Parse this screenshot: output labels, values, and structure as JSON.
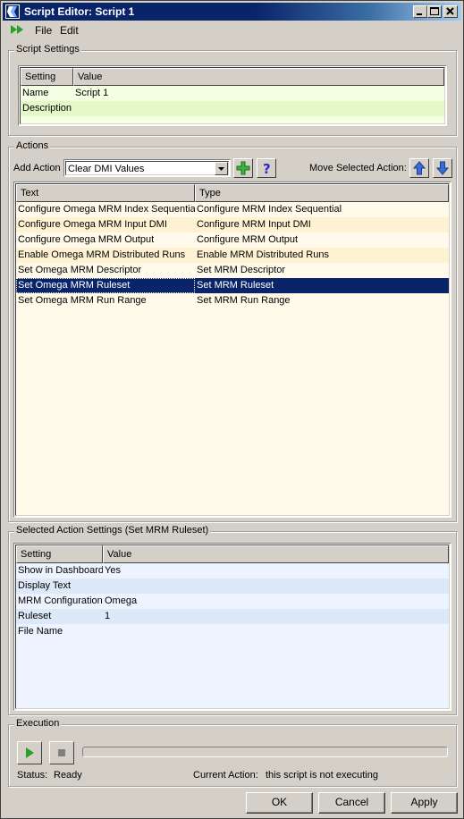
{
  "window": {
    "title": "Script Editor: Script 1"
  },
  "menu": {
    "file": "File",
    "edit": "Edit"
  },
  "script_settings": {
    "title": "Script Settings",
    "columns": [
      "Setting",
      "Value"
    ],
    "rows": [
      {
        "setting": "Name",
        "value": "Script 1"
      },
      {
        "setting": "Description",
        "value": ""
      }
    ]
  },
  "actions": {
    "title": "Actions",
    "add_action_label": "Add Action",
    "add_action_value": "Clear DMI Values",
    "move_label": "Move Selected Action:",
    "columns": [
      "Text",
      "Type"
    ],
    "rows": [
      {
        "text": "Configure Omega MRM Index Sequential",
        "type": "Configure MRM Index Sequential"
      },
      {
        "text": "Configure Omega MRM Input DMI",
        "type": "Configure MRM Input DMI"
      },
      {
        "text": "Configure Omega MRM Output",
        "type": "Configure MRM Output"
      },
      {
        "text": "Enable Omega MRM Distributed Runs",
        "type": "Enable MRM Distributed Runs"
      },
      {
        "text": "Set Omega MRM Descriptor",
        "type": "Set MRM Descriptor"
      },
      {
        "text": "Set Omega MRM Ruleset",
        "type": "Set MRM Ruleset"
      },
      {
        "text": "Set Omega MRM Run Range",
        "type": "Set MRM Run Range"
      }
    ],
    "selected_index": 5
  },
  "selected_action_settings": {
    "title": "Selected Action Settings (Set MRM Ruleset)",
    "columns": [
      "Setting",
      "Value"
    ],
    "rows": [
      {
        "setting": "Show in Dashboard",
        "value": "Yes"
      },
      {
        "setting": "Display Text",
        "value": ""
      },
      {
        "setting": "MRM Configuration",
        "value": "Omega"
      },
      {
        "setting": "Ruleset",
        "value": "1"
      },
      {
        "setting": "File Name",
        "value": ""
      }
    ]
  },
  "execution": {
    "title": "Execution",
    "progress": 0,
    "status_label": "Status:",
    "status_value": "Ready",
    "current_action_label": "Current Action:",
    "current_action_value": "this script is not executing"
  },
  "buttons": {
    "ok": "OK",
    "cancel": "Cancel",
    "apply": "Apply"
  },
  "colors": {
    "title_bar": "#0a246a",
    "selection": "#0a246a",
    "script_row_even": "#f4ffe4",
    "script_row_odd": "#e4f8c8",
    "action_row_even": "#fffaea",
    "action_row_odd": "#fff2d2",
    "setting_row_even": "#eef4ff",
    "setting_row_odd": "#dde8f8"
  },
  "icons": {
    "app": "script-editor-app-icon",
    "run_script": "run-script-icon",
    "add": "add-action-icon",
    "help": "help-icon",
    "move_up": "move-up-icon",
    "move_down": "move-down-icon",
    "play": "play-icon",
    "stop": "stop-icon"
  }
}
